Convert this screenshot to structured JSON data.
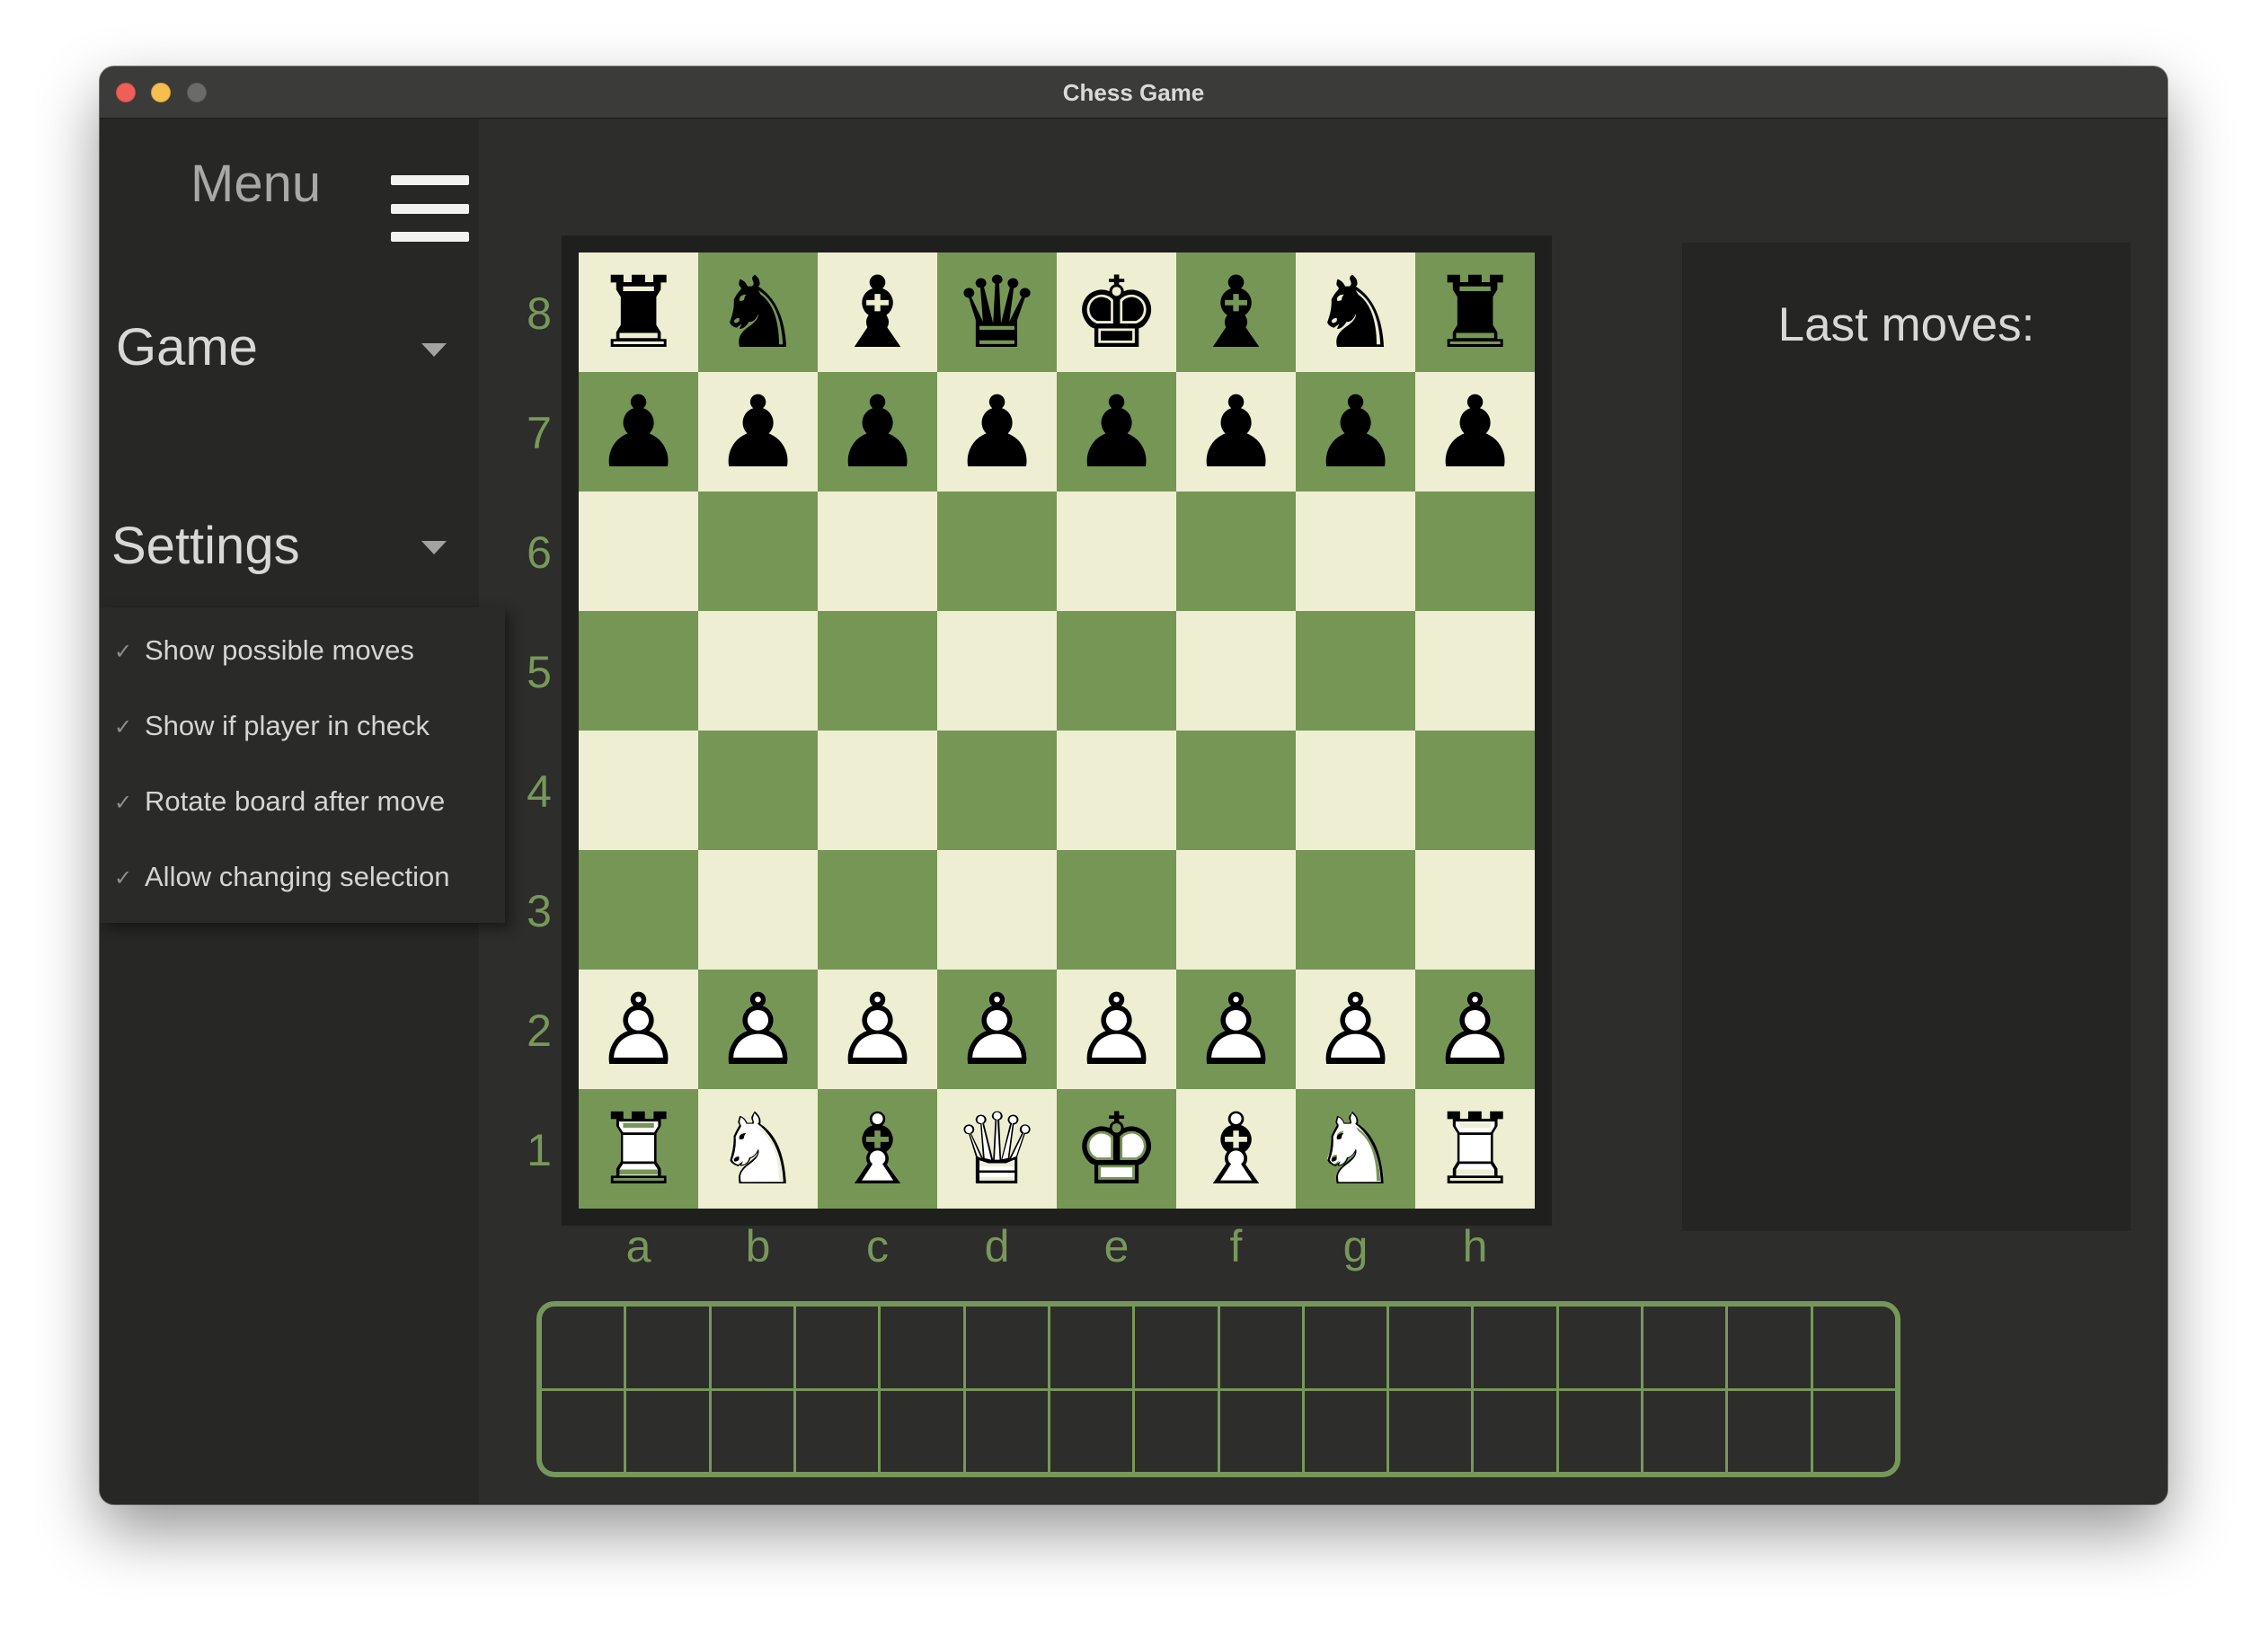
{
  "window": {
    "title": "Chess Game"
  },
  "sidebar": {
    "menu_label": "Menu",
    "menu_icon": "hamburger-menu-icon",
    "game_label": "Game",
    "settings_label": "Settings",
    "caret_icon": "chevron-down-icon",
    "settings_options": [
      {
        "check": "✓",
        "label": "Show possible moves",
        "checked": true
      },
      {
        "check": "✓",
        "label": "Show if player in check",
        "checked": true
      },
      {
        "check": "✓",
        "label": "Rotate board after move",
        "checked": true
      },
      {
        "check": "✓",
        "label": "Allow changing selection",
        "checked": true
      }
    ]
  },
  "board": {
    "ranks": [
      "8",
      "7",
      "6",
      "5",
      "4",
      "3",
      "2",
      "1"
    ],
    "files": [
      "a",
      "b",
      "c",
      "d",
      "e",
      "f",
      "g",
      "h"
    ],
    "rows": [
      [
        "♜",
        "♞",
        "♝",
        "♛",
        "♚",
        "♝",
        "♞",
        "♜"
      ],
      [
        "♟",
        "♟",
        "♟",
        "♟",
        "♟",
        "♟",
        "♟",
        "♟"
      ],
      [
        "",
        "",
        "",
        "",
        "",
        "",
        "",
        ""
      ],
      [
        "",
        "",
        "",
        "",
        "",
        "",
        "",
        ""
      ],
      [
        "",
        "",
        "",
        "",
        "",
        "",
        "",
        ""
      ],
      [
        "",
        "",
        "",
        "",
        "",
        "",
        "",
        ""
      ],
      [
        "♙",
        "♙",
        "♙",
        "♙",
        "♙",
        "♙",
        "♙",
        "♙"
      ],
      [
        "♖",
        "♘",
        "♗",
        "♕",
        "♔",
        "♗",
        "♘",
        "♖"
      ]
    ]
  },
  "last_moves": {
    "title": "Last moves:",
    "moves": []
  },
  "colors": {
    "light_square": "#eeeed2",
    "dark_square": "#769656",
    "accent_green": "#76975a"
  }
}
